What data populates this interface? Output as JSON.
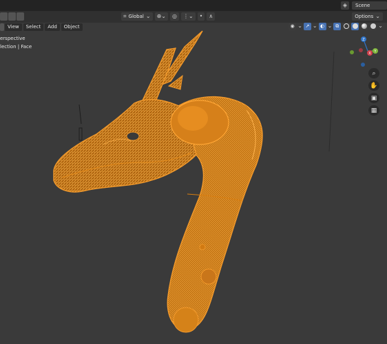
{
  "topbar": {
    "scene_label": "Scene",
    "scene_icon": "scene-icon"
  },
  "header": {
    "orientation_label": "Global",
    "options_label": "Options",
    "icons": [
      "transform-orientation-icon",
      "pivot-icon",
      "snap-icon",
      "proportional-edit-icon"
    ]
  },
  "menu": {
    "view": "View",
    "select": "Select",
    "add": "Add",
    "object": "Object"
  },
  "viewport_info": {
    "line1": "erspective",
    "line2": "lection | Face"
  },
  "gizmo": {
    "z": "Z",
    "x": "X",
    "y": "Y",
    "colors": {
      "x": "#d03f4b",
      "y": "#7fb63c",
      "z": "#2f74c9"
    }
  },
  "navigation": {
    "icons": [
      "zoom-icon",
      "hand-icon",
      "camera-icon",
      "grid-view-icon"
    ]
  },
  "mesh": {
    "name": "dragon-wireframe",
    "selected_color": "#f08a10"
  }
}
